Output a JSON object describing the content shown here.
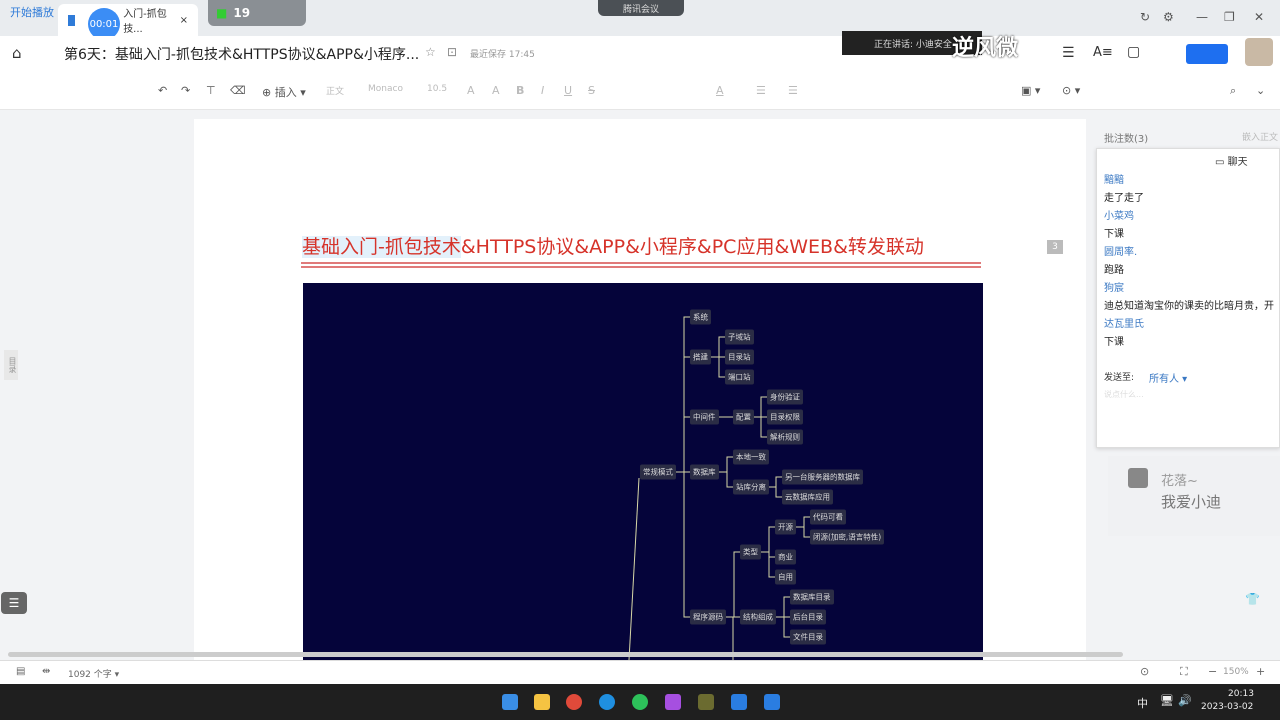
{
  "browser": {
    "play_label": "开始播放",
    "tab_title": "第6天：基础入门-抓包技术...",
    "tab_title_short": "入门-抓包技...",
    "recording_time": "00:01",
    "widget_value": "19",
    "meeting_label": "腾讯会议"
  },
  "header": {
    "doc_title": "第6天：基础入门-抓包技术&HTTPS协议&APP&小程序...",
    "saved_status": "最近保存 17:45",
    "speaking": "正在讲话: 小迪安全",
    "overlay_text": "逆风微"
  },
  "toolbar": {
    "insert": "插入",
    "style": "正文",
    "font": "Monaco",
    "size": "10.5"
  },
  "document": {
    "heading_selected": "基础入门-抓包技术",
    "heading_rest": "&HTTPS协议&APP&小程序&PC应用&WEB&转发联动",
    "comment_badge": "3",
    "toc_label": "目录",
    "mindmap": [
      "常规模式",
      "系统",
      "搭建",
      "子域站",
      "目录站",
      "端口站",
      "中间件",
      "配置",
      "身份验证",
      "目录权限",
      "解析规则",
      "数据库",
      "本地一致",
      "站库分离",
      "另一台服务器的数据库",
      "云数据库应用",
      "程序源码",
      "类型",
      "开源",
      "代码可看",
      "闭源(加密,语言特性)",
      "商业",
      "自用",
      "结构组成",
      "数据库目录",
      "后台目录",
      "文件目录"
    ]
  },
  "sidebar": {
    "comment_count": "批注数(3)",
    "right_label": "嵌入正文",
    "chat_title": "聊天",
    "messages": [
      {
        "name": "黯黯",
        "text": "走了走了"
      },
      {
        "name": "小菜鸡",
        "text": "下课"
      },
      {
        "name": "圆周率.",
        "text": "跑路"
      },
      {
        "name": "狗宸",
        "text": "迪总知道淘宝你的课卖的比暗月贵，开"
      },
      {
        "name": "达瓦里氏",
        "text": "下课"
      }
    ],
    "send_to_label": "发送至:",
    "send_to_value": "所有人",
    "input_placeholder": "说点什么..."
  },
  "danmu": {
    "user": "花落~",
    "text": "我爱小迪"
  },
  "status": {
    "word_count": "1092 个字",
    "zoom": "150%"
  },
  "taskbar": {
    "time": "20:13",
    "date": "2023-03-02",
    "ime": "中"
  }
}
